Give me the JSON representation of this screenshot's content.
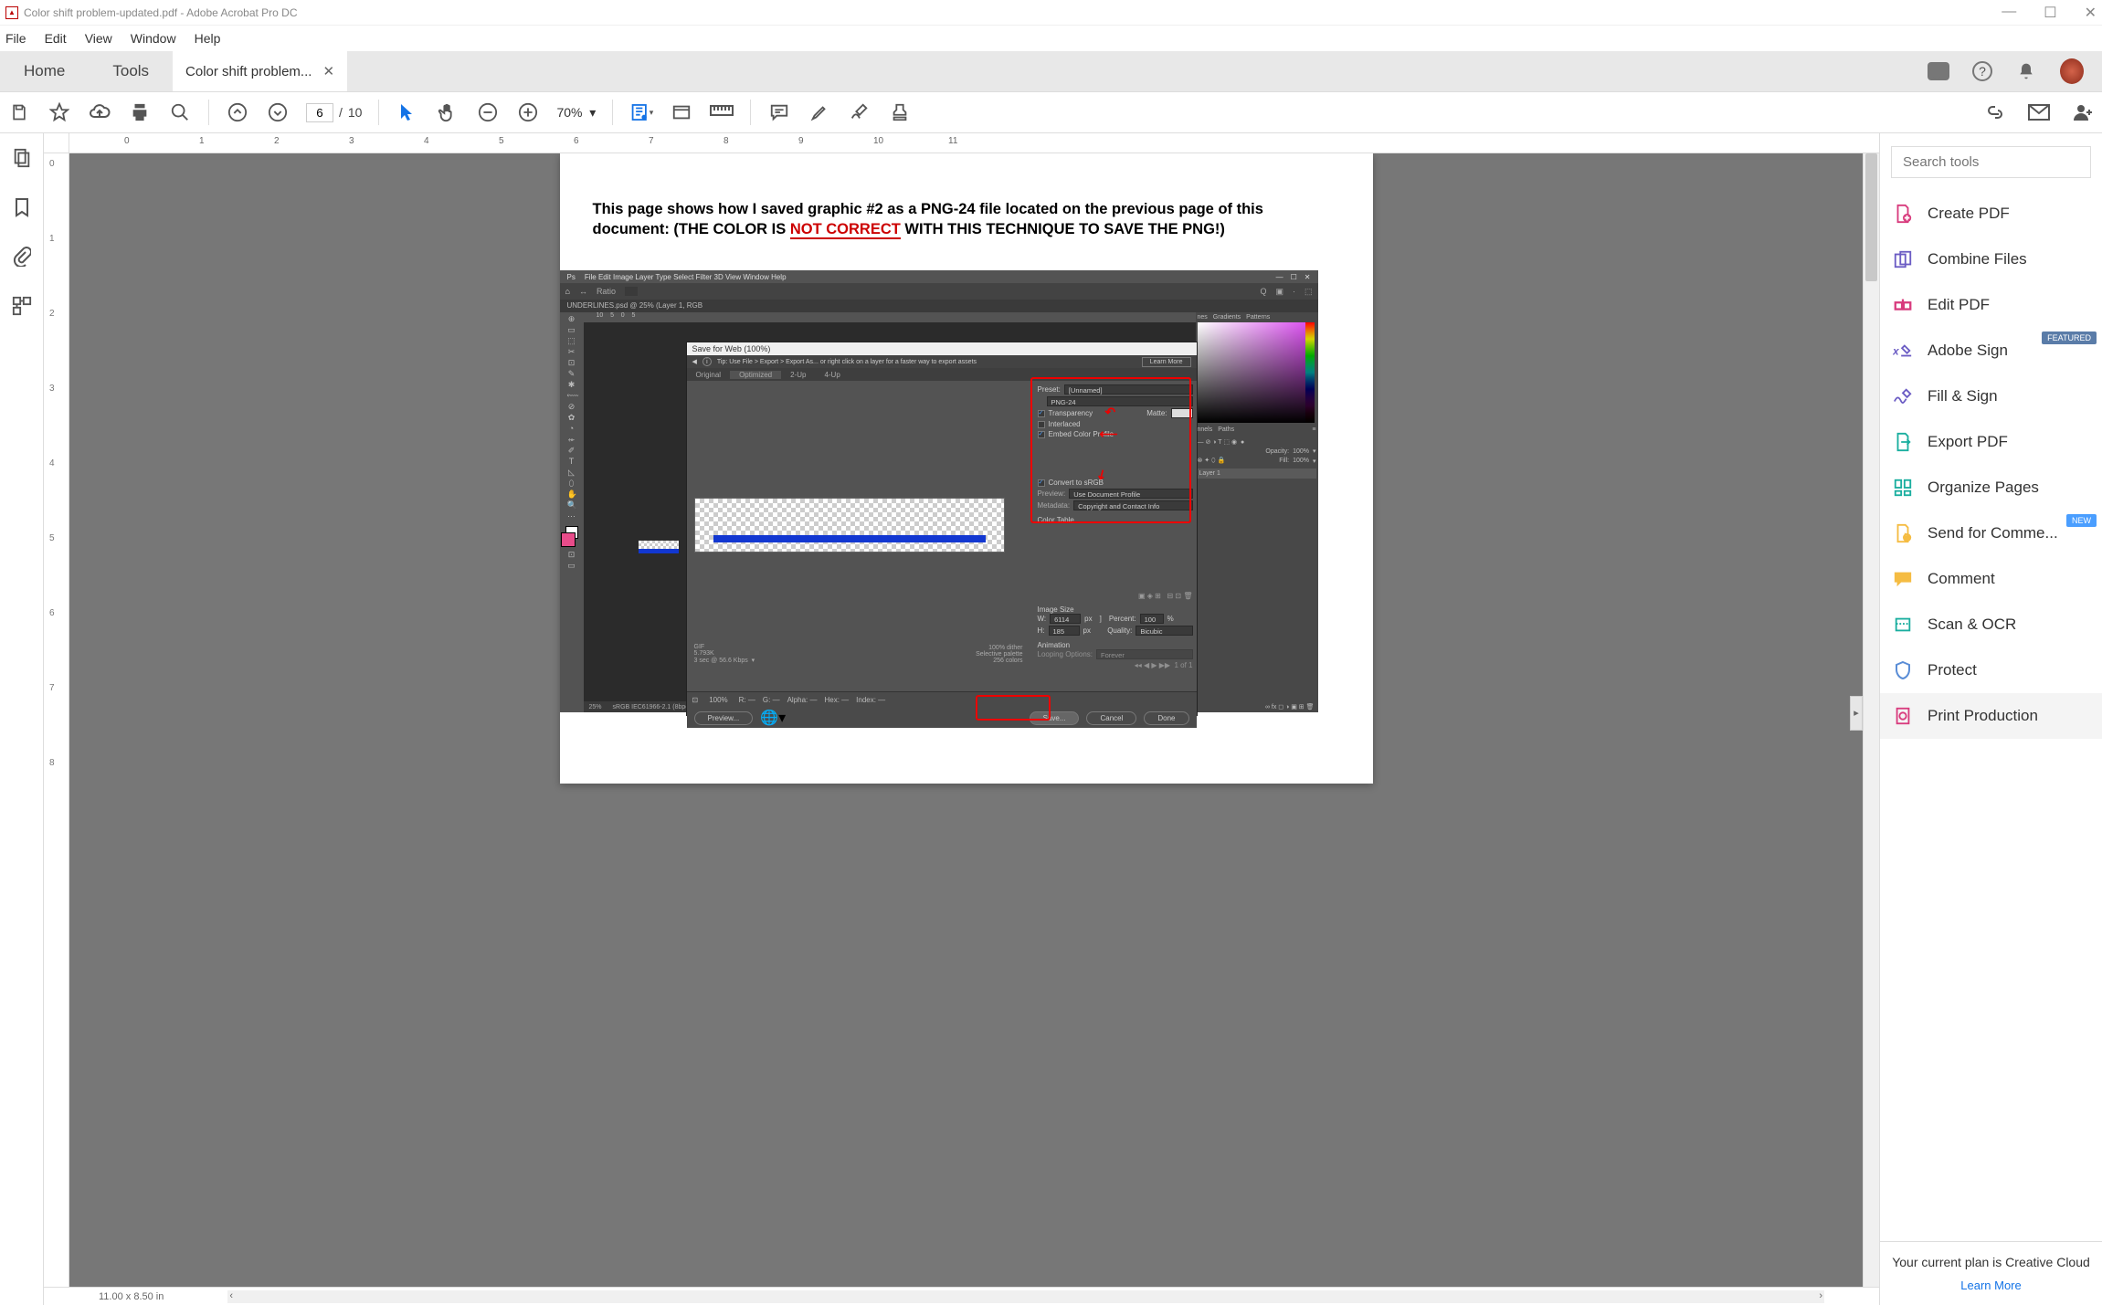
{
  "window": {
    "title": "Color shift problem-updated.pdf - Adobe Acrobat Pro DC",
    "min": "—",
    "max": "☐",
    "close": "✕"
  },
  "menu": {
    "file": "File",
    "edit": "Edit",
    "view": "View",
    "window": "Window",
    "help": "Help"
  },
  "tabs": {
    "home": "Home",
    "tools": "Tools",
    "doc": "Color shift problem...",
    "docClose": "✕"
  },
  "toolbar": {
    "page_current": "6",
    "page_sep": "/",
    "page_total": "10",
    "zoom": "70%"
  },
  "doc": {
    "heading_a": "This page shows how I saved graphic #2 as a PNG-24 file located on the previous page of this document: (THE COLOR IS ",
    "heading_red": "NOT CORRECT",
    "heading_b": " WITH THIS TECHNIQUE TO SAVE THE PNG!)"
  },
  "ps": {
    "menus": [
      "File",
      "Edit",
      "Image",
      "Layer",
      "Type",
      "Select",
      "Filter",
      "3D",
      "View",
      "Window",
      "Help"
    ],
    "ratio": "Ratio",
    "doctab": "UNDERLINES.psd @ 25% (Layer 1, RGB",
    "ruler_marks": [
      "10",
      "5",
      "0",
      "5"
    ],
    "status_zoom": "25%",
    "status_profile": "sRGB IEC61966-2.1 (8bpc)",
    "status_arrow": ">",
    "panel_tabs": [
      "nes",
      "Gradients",
      "Patterns"
    ],
    "panel_tabs2": [
      "nnels",
      "Paths"
    ],
    "opacity_lbl": "Opacity:",
    "opacity_val": "100%",
    "fill_lbl": "Fill:",
    "fill_val": "100%",
    "layer1": "Layer 1",
    "bottom_icons": "∞  fx  ◻  ◑  ▣  ⊞  🗑"
  },
  "sfw": {
    "title": "Save for Web (100%)",
    "tip": "Tip: Use File > Export > Export As...   or right click on a layer for a faster way to export assets",
    "learn": "Learn More",
    "tabs": [
      "Original",
      "Optimized",
      "2-Up",
      "4-Up"
    ],
    "preset_lbl": "Preset:",
    "preset_val": "[Unnamed]",
    "format": "PNG-24",
    "transparency": "Transparency",
    "matte_lbl": "Matte:",
    "interlaced": "Interlaced",
    "embed": "Embed Color Profile",
    "convert": "Convert to sRGB",
    "preview_lbl": "Preview:",
    "preview_val": "Use Document Profile",
    "meta_lbl": "Metadata:",
    "meta_val": "Copyright and Contact Info",
    "colortable": "Color Table",
    "imagesize": "Image Size",
    "w_lbl": "W:",
    "w_val": "6114",
    "w_unit": "px",
    "percent_lbl": "Percent:",
    "percent_val": "100",
    "h_lbl": "H:",
    "h_val": "185",
    "h_unit": "px",
    "quality_lbl": "Quality:",
    "quality_val": "Bicubic",
    "animation": "Animation",
    "loop_lbl": "Looping Options:",
    "loop_val": "Forever",
    "info_fmt": "GIF",
    "info_size": "5.793K",
    "info_speed": "3 sec @ 56.6 Kbps",
    "info_dither": "100% dither",
    "info_pal": "Selective palette",
    "info_colors": "256 colors",
    "foot_zoom": "100%",
    "foot_r": "R: —",
    "foot_g": "G: —",
    "foot_alpha": "Alpha: —",
    "foot_hex": "Hex: —",
    "foot_index": "Index: —",
    "preview_btn": "Preview...",
    "save": "Save...",
    "cancel": "Cancel",
    "done": "Done"
  },
  "right": {
    "search_ph": "Search tools",
    "tools": [
      {
        "label": "Create PDF",
        "color": "#d83b7d",
        "icon": "create"
      },
      {
        "label": "Combine Files",
        "color": "#6b5cc4",
        "icon": "combine"
      },
      {
        "label": "Edit PDF",
        "color": "#d83b7d",
        "icon": "edit"
      },
      {
        "label": "Adobe Sign",
        "color": "#6b5cc4",
        "icon": "sign",
        "badge": "FEATURED",
        "badgeClass": "featured"
      },
      {
        "label": "Fill & Sign",
        "color": "#6b5cc4",
        "icon": "fill"
      },
      {
        "label": "Export PDF",
        "color": "#1aae9f",
        "icon": "export"
      },
      {
        "label": "Organize Pages",
        "color": "#1aae9f",
        "icon": "organize"
      },
      {
        "label": "Send for Comme...",
        "color": "#f5bc42",
        "icon": "send",
        "badge": "NEW",
        "badgeClass": "new"
      },
      {
        "label": "Comment",
        "color": "#f5bc42",
        "icon": "comment"
      },
      {
        "label": "Scan & OCR",
        "color": "#1aae9f",
        "icon": "scan"
      },
      {
        "label": "Protect",
        "color": "#5a8dd6",
        "icon": "protect"
      },
      {
        "label": "Print Production",
        "color": "#d83b7d",
        "icon": "print",
        "trunc": true
      }
    ],
    "plan": "Your current plan is Creative Cloud",
    "learn": "Learn More"
  },
  "status": {
    "dims": "11.00 x 8.50 in"
  },
  "hruler": [
    "0",
    "1",
    "2",
    "3",
    "4",
    "5",
    "6",
    "7",
    "8",
    "9",
    "10",
    "11"
  ],
  "vruler": [
    "0",
    "1",
    "2",
    "3",
    "4",
    "5",
    "6",
    "7",
    "8"
  ]
}
